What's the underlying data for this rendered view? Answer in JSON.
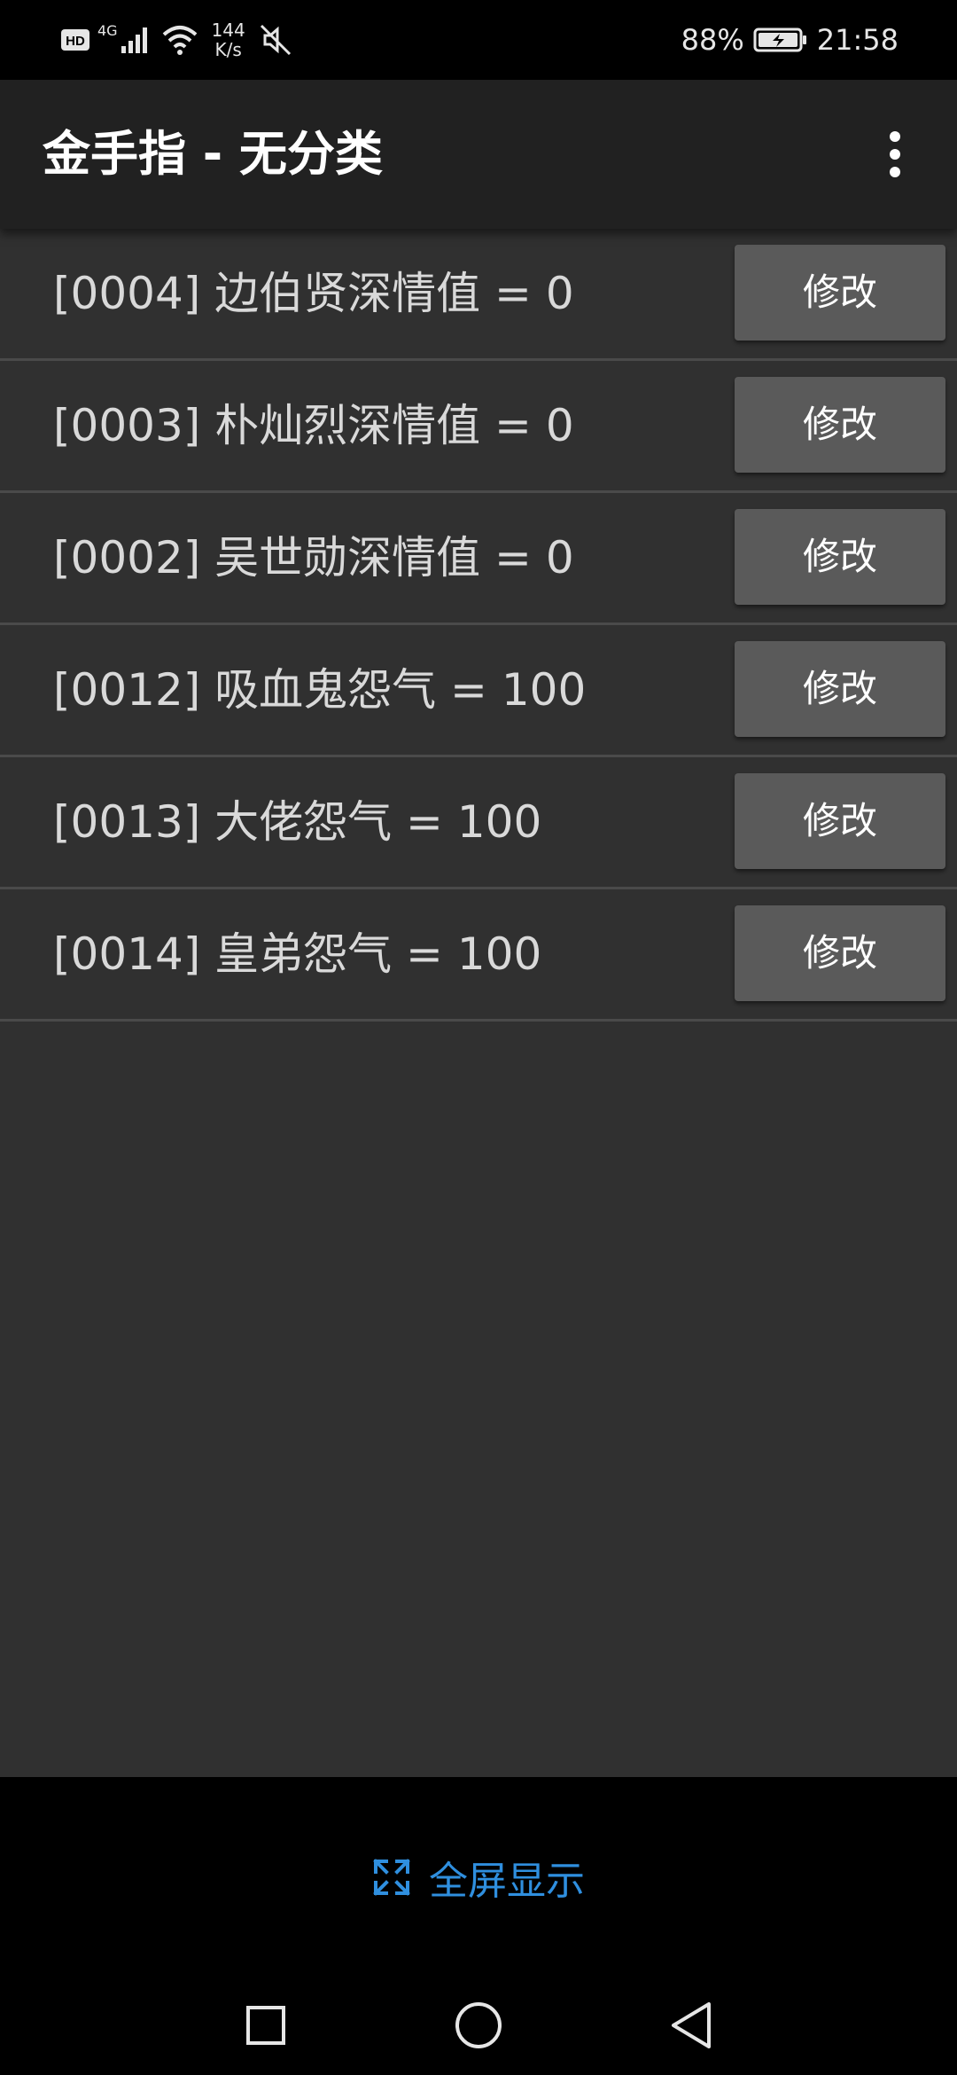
{
  "status_bar": {
    "net_badge": "HD",
    "net_type": "4G",
    "speed_value": "144",
    "speed_unit": "K/s",
    "battery": "88%",
    "time": "21:58",
    "icons": [
      "hd-icon",
      "signal-icon",
      "wifi-icon",
      "mute-icon",
      "battery-charging-icon"
    ]
  },
  "app_bar": {
    "title": "金手指 - 无分类",
    "menu_icon": "more-vert-icon"
  },
  "cheats": [
    {
      "label": "[0004] 边伯贤深情值 = 0",
      "button": "修改"
    },
    {
      "label": "[0003] 朴灿烈深情值 = 0",
      "button": "修改"
    },
    {
      "label": "[0002] 吴世勋深情值 = 0",
      "button": "修改"
    },
    {
      "label": "[0012] 吸血鬼怨气 = 100",
      "button": "修改"
    },
    {
      "label": "[0013] 大佬怨气 = 100",
      "button": "修改"
    },
    {
      "label": "[0014] 皇弟怨气 = 100",
      "button": "修改"
    }
  ],
  "bottom": {
    "fullscreen_label": "全屏显示",
    "fullscreen_icon": "fullscreen-icon",
    "accent": "#2f8fdf"
  },
  "nav": {
    "icons": [
      "recents-square-icon",
      "home-circle-icon",
      "back-triangle-icon"
    ]
  }
}
